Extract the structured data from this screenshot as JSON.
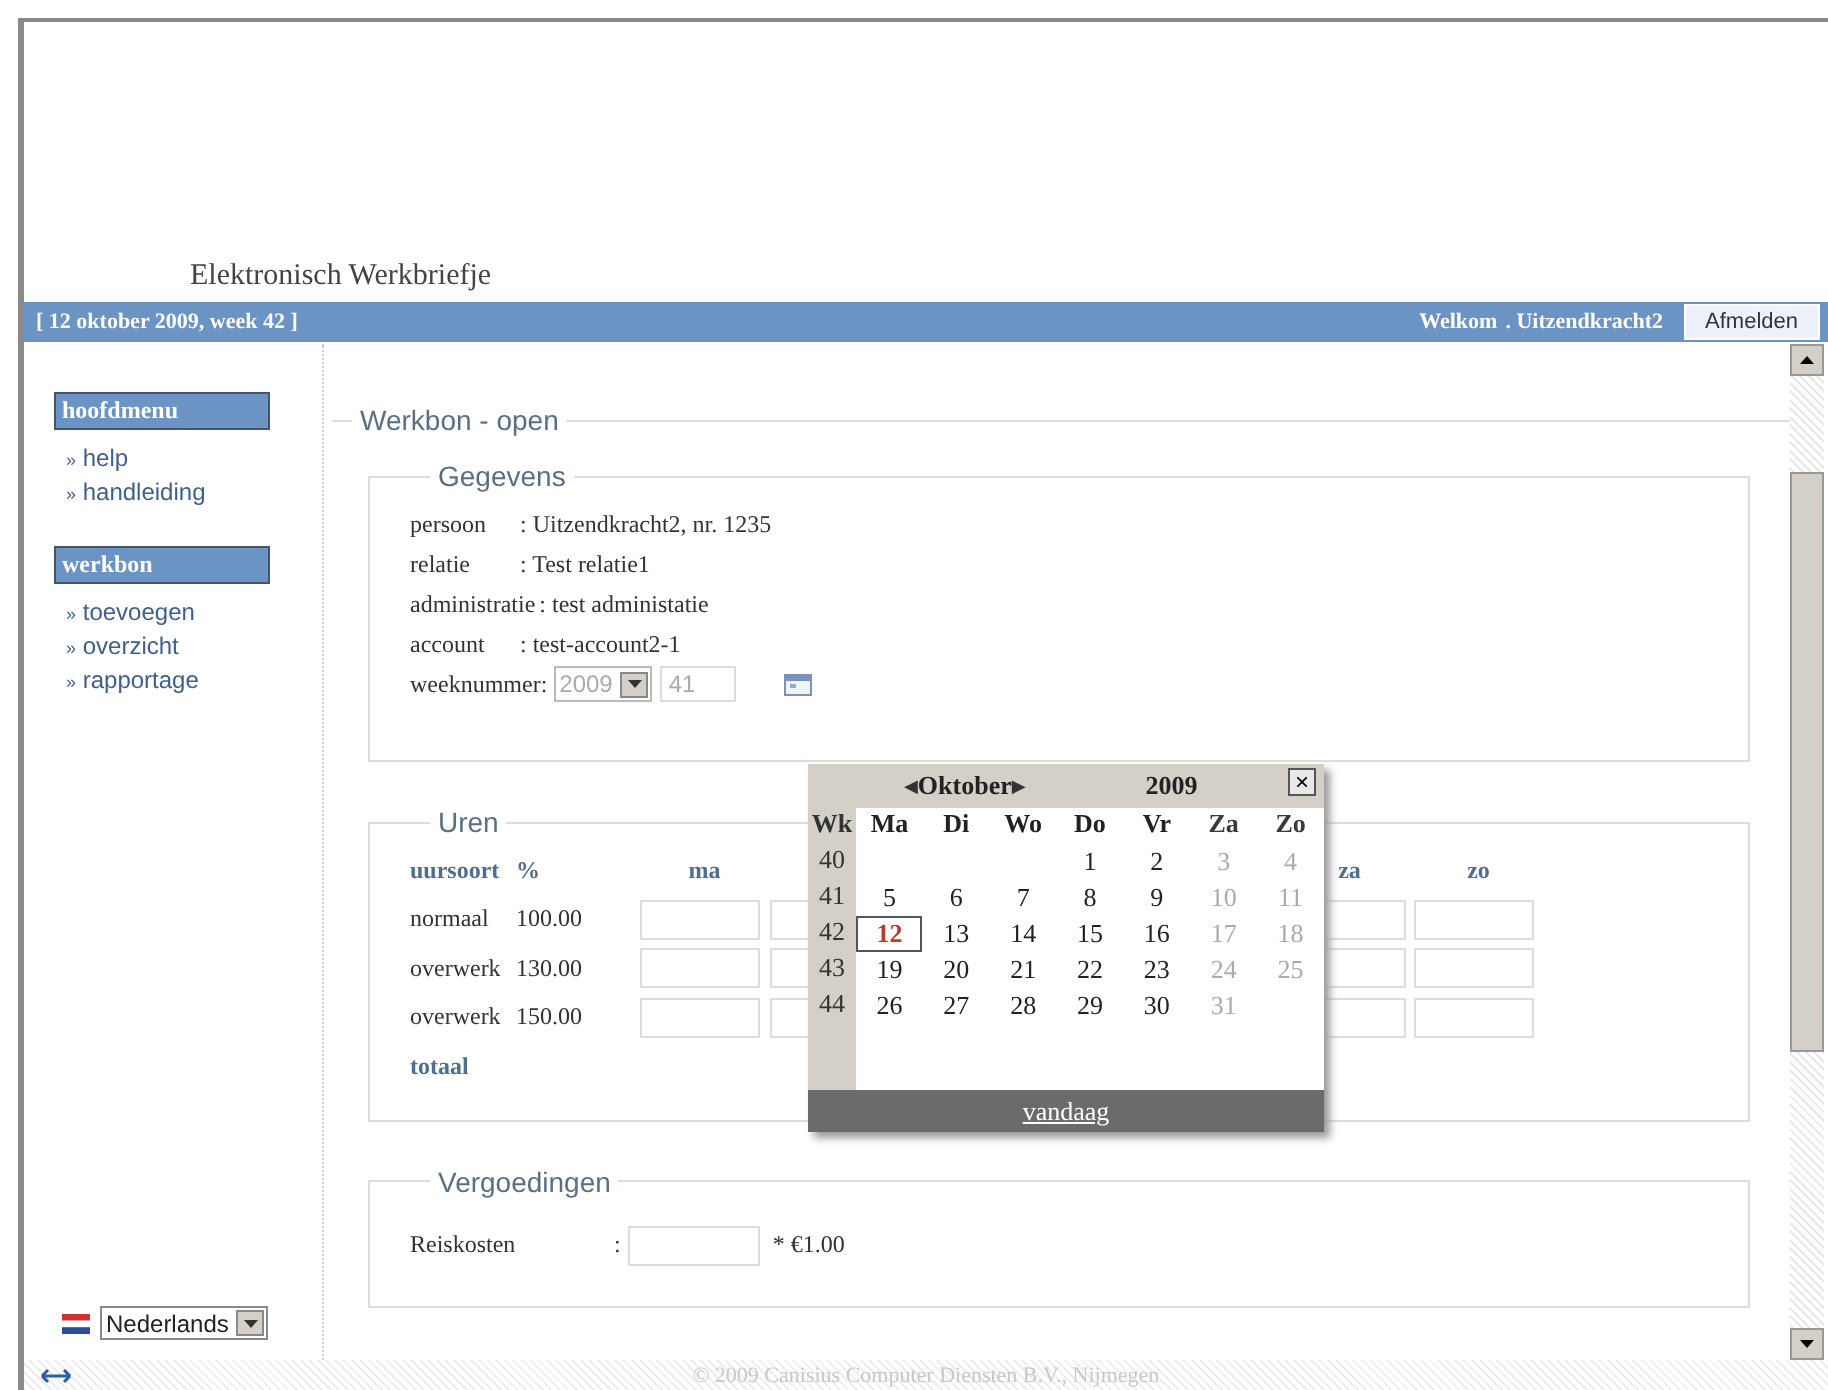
{
  "header": {
    "title": "Elektronisch Werkbriefje",
    "date": "[ 12 oktober 2009, week 42 ]",
    "welcome": "Welkom",
    "user": ". Uitzendkracht2",
    "logout": "Afmelden"
  },
  "sidebar": {
    "sections": [
      {
        "title": "hoofdmenu",
        "items": [
          {
            "marker": "»",
            "label": "help"
          },
          {
            "marker": "»",
            "label": "handleiding"
          }
        ]
      },
      {
        "title": "werkbon",
        "items": [
          {
            "marker": "»",
            "label": "toevoegen"
          },
          {
            "marker": "»",
            "label": "overzicht"
          },
          {
            "marker": "»",
            "label": "rapportage"
          }
        ]
      }
    ],
    "language": "Nederlands"
  },
  "page_title": "Werkbon - open",
  "gegevens": {
    "title": "Gegevens",
    "fields": [
      {
        "label": "persoon",
        "value": ": Uitzendkracht2, nr. 1235"
      },
      {
        "label": "relatie",
        "value": ": Test relatie1"
      },
      {
        "label": "administratie",
        "value": ": test administatie"
      },
      {
        "label": "account",
        "value": ": test-account2-1"
      }
    ],
    "week": {
      "label": "weeknummer",
      "separator": ":",
      "year": "2009",
      "week": "41",
      "disabled": true
    }
  },
  "uren": {
    "title": "Uren",
    "type_header": "uursoort",
    "percent_header": "%",
    "day_columns": [
      {
        "kind": "shown",
        "label": "ma"
      },
      {
        "kind": "partial"
      },
      {
        "kind": "hidden"
      },
      {
        "kind": "hidden"
      },
      {
        "kind": "hidden"
      },
      {
        "kind": "shown",
        "label": "za"
      },
      {
        "kind": "shown",
        "label": "zo"
      }
    ],
    "rows": [
      {
        "type": "normaal",
        "percent": "100.00"
      },
      {
        "type": "overwerk",
        "percent": "130.00"
      },
      {
        "type": "overwerk",
        "percent": "150.00"
      }
    ],
    "total": "totaal"
  },
  "vergoedingen": {
    "title": "Vergoedingen",
    "label": "Reiskosten",
    "separator": ":",
    "rate": "* €1.00"
  },
  "calendar": {
    "prev": "◀",
    "month": "Oktober",
    "next": "▶",
    "year": "2009",
    "close": "×",
    "week_header": "Wk",
    "day_headers": [
      {
        "label": "Ma",
        "weekend": false
      },
      {
        "label": "Di",
        "weekend": false
      },
      {
        "label": "Wo",
        "weekend": false
      },
      {
        "label": "Do",
        "weekend": false
      },
      {
        "label": "Vr",
        "weekend": false
      },
      {
        "label": "Za",
        "weekend": true
      },
      {
        "label": "Zo",
        "weekend": true
      }
    ],
    "weeks": [
      {
        "wk": "40",
        "days": [
          {
            "kind": "blank"
          },
          {
            "kind": "blank"
          },
          {
            "kind": "blank"
          },
          {
            "kind": "day",
            "n": "1",
            "today": false
          },
          {
            "kind": "day",
            "n": "2",
            "today": false
          },
          {
            "kind": "day",
            "n": "3",
            "today": false
          },
          {
            "kind": "day",
            "n": "4",
            "today": false
          }
        ]
      },
      {
        "wk": "41",
        "days": [
          {
            "kind": "day",
            "n": "5",
            "today": false
          },
          {
            "kind": "day",
            "n": "6",
            "today": false
          },
          {
            "kind": "day",
            "n": "7",
            "today": false
          },
          {
            "kind": "day",
            "n": "8",
            "today": false
          },
          {
            "kind": "day",
            "n": "9",
            "today": false
          },
          {
            "kind": "day",
            "n": "10",
            "today": false
          },
          {
            "kind": "day",
            "n": "11",
            "today": false
          }
        ]
      },
      {
        "wk": "42",
        "days": [
          {
            "kind": "day",
            "n": "12",
            "today": true
          },
          {
            "kind": "day",
            "n": "13",
            "today": false
          },
          {
            "kind": "day",
            "n": "14",
            "today": false
          },
          {
            "kind": "day",
            "n": "15",
            "today": false
          },
          {
            "kind": "day",
            "n": "16",
            "today": false
          },
          {
            "kind": "day",
            "n": "17",
            "today": false
          },
          {
            "kind": "day",
            "n": "18",
            "today": false
          }
        ]
      },
      {
        "wk": "43",
        "days": [
          {
            "kind": "day",
            "n": "19",
            "today": false
          },
          {
            "kind": "day",
            "n": "20",
            "today": false
          },
          {
            "kind": "day",
            "n": "21",
            "today": false
          },
          {
            "kind": "day",
            "n": "22",
            "today": false
          },
          {
            "kind": "day",
            "n": "23",
            "today": false
          },
          {
            "kind": "day",
            "n": "24",
            "today": false
          },
          {
            "kind": "day",
            "n": "25",
            "today": false
          }
        ]
      },
      {
        "wk": "44",
        "days": [
          {
            "kind": "day",
            "n": "26",
            "today": false
          },
          {
            "kind": "day",
            "n": "27",
            "today": false
          },
          {
            "kind": "day",
            "n": "28",
            "today": false
          },
          {
            "kind": "day",
            "n": "29",
            "today": false
          },
          {
            "kind": "day",
            "n": "30",
            "today": false
          },
          {
            "kind": "day",
            "n": "31",
            "today": false
          },
          {
            "kind": "blank"
          }
        ]
      }
    ],
    "today_link": "vandaag"
  },
  "footer": "© 2009 Canisius Computer Diensten B.V., Nijmegen"
}
